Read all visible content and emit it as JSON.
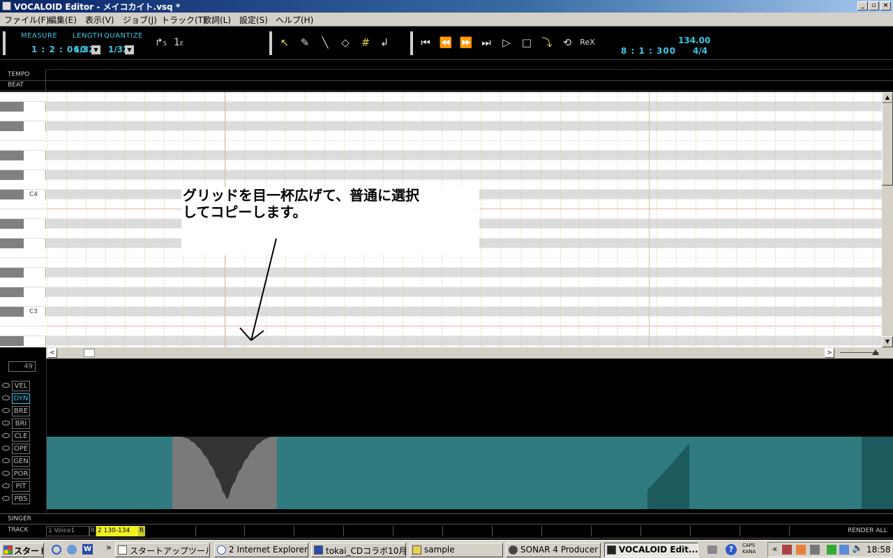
{
  "window": {
    "title": "VOCALOID Editor - メイコカイト.vsq *",
    "min_label": "_",
    "max_label": "▫",
    "close_label": "×"
  },
  "menu": [
    {
      "label": "ファイル(F)"
    },
    {
      "label": "編集(E)"
    },
    {
      "label": "表示(V)"
    },
    {
      "label": "ジョブ(J)"
    },
    {
      "label": "トラック(T)"
    },
    {
      "label": "歌詞(L)"
    },
    {
      "label": "設定(S)"
    },
    {
      "label": "ヘルプ(H)"
    }
  ],
  "toolbar": {
    "measure_label": "MEASURE",
    "length_label": "LENGTH",
    "quantize_label": "QUANTIZE",
    "measure_value": "1 : 2 : 060",
    "length_value": "1/32",
    "quantize_value": "1/32",
    "position_value": "8 : 1 : 300",
    "tempo_value": "134.00",
    "time_signature": "4/4",
    "start_marker": "S",
    "end_marker": "E"
  },
  "rulers": {
    "tempo_label": "TEMPO",
    "beat_label": "BEAT"
  },
  "piano": {
    "c4_label": "C4",
    "c3_label": "C3"
  },
  "callout": {
    "line1": "グリッドを目一杯広げて、普通に選択",
    "line2": "してコピーします。"
  },
  "control": {
    "value_box": "49",
    "params": [
      "VEL",
      "DYN",
      "BRE",
      "BRI",
      "CLE",
      "OPE",
      "GEN",
      "POR",
      "PIT",
      "PBS"
    ],
    "active_param": "DYN",
    "teal_color": "#2f7b80",
    "selection_color": "#7a7a7a"
  },
  "singer_label": "SINGER",
  "track": {
    "label": "TRACK",
    "track1": "1  Voice1",
    "track1_flag": "R",
    "track2": "2 130-134",
    "track2_flag": "R",
    "render_all": "RENDER ALL"
  },
  "taskbar": {
    "start": "スタート",
    "chevron": "»",
    "items": [
      {
        "label": "スタートアップツール"
      },
      {
        "label": "2 Internet Explorer"
      },
      {
        "label": "tokai_CDコラボ10月..."
      },
      {
        "label": "sample"
      },
      {
        "label": "SONAR 4 Producer ..."
      },
      {
        "label": "VOCALOID Edit..."
      }
    ],
    "caps": "CAPS",
    "kana": "KANA",
    "clock": "18:58"
  }
}
